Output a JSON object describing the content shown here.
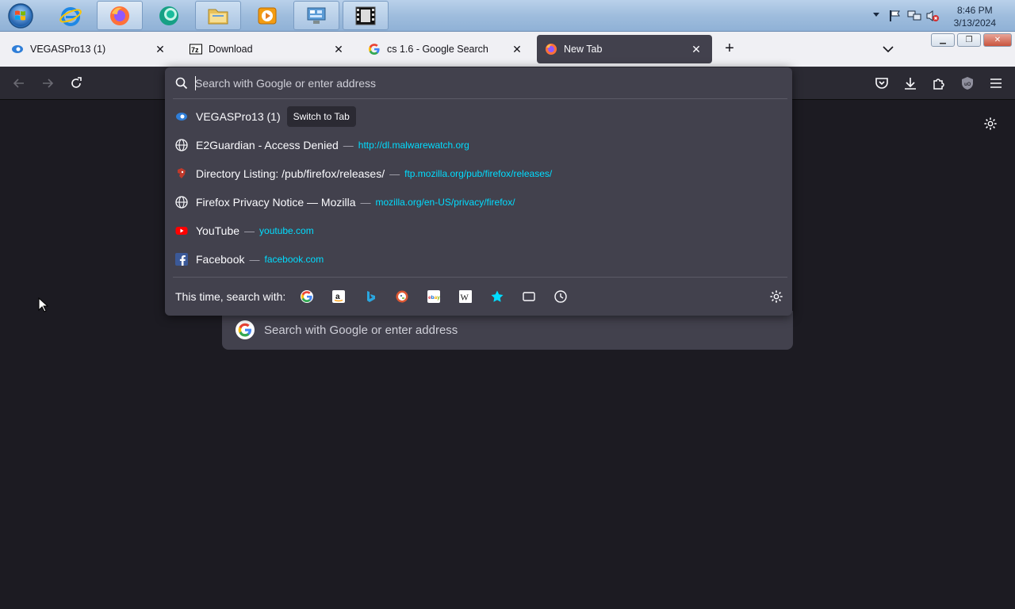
{
  "taskbar": {
    "apps": [
      {
        "name": "internet-explorer",
        "icon": "ie-icon"
      },
      {
        "name": "firefox",
        "icon": "firefox-icon"
      },
      {
        "name": "chat-app",
        "icon": "green-bubble-icon"
      },
      {
        "name": "file-explorer",
        "icon": "folder-icon"
      },
      {
        "name": "media-player",
        "icon": "media-player-icon"
      },
      {
        "name": "control-panel",
        "icon": "control-panel-icon"
      },
      {
        "name": "video-editor",
        "icon": "film-strip-icon"
      }
    ],
    "clock": {
      "time": "8:46 PM",
      "date": "3/13/2024"
    }
  },
  "tabs": [
    {
      "title": "VEGASPro13 (1)",
      "icon": "vegas-icon",
      "selected": false
    },
    {
      "title": "Download",
      "icon": "7zip-icon",
      "selected": false
    },
    {
      "title": "cs 1.6 - Google Search",
      "icon": "google-icon",
      "selected": false
    },
    {
      "title": "New Tab",
      "icon": "firefox-icon",
      "selected": true
    }
  ],
  "urlbar": {
    "placeholder": "Search with Google or enter address",
    "results": [
      {
        "title": "VEGASPro13 (1)",
        "action": "Switch to Tab",
        "url": "",
        "icon": "vegas-icon"
      },
      {
        "title": "E2Guardian - Access Denied",
        "url": "http://dl.malwarewatch.org",
        "icon": "globe-icon"
      },
      {
        "title": "Directory Listing: /pub/firefox/releases/",
        "url": "ftp.mozilla.org/pub/firefox/releases/",
        "icon": "mozilla-icon"
      },
      {
        "title": "Firefox Privacy Notice — Mozilla",
        "url": "mozilla.org/en-US/privacy/firefox/",
        "icon": "globe-icon"
      },
      {
        "title": "YouTube",
        "url": "youtube.com",
        "icon": "youtube-icon"
      },
      {
        "title": "Facebook",
        "url": "facebook.com",
        "icon": "facebook-icon"
      }
    ],
    "separator": "—",
    "oneoff_label": "This time, search with:",
    "engines": [
      "google",
      "amazon",
      "bing",
      "duckduckgo",
      "ebay",
      "wikipedia",
      "bookmarks",
      "tabs",
      "history"
    ]
  },
  "content": {
    "search_placeholder": "Search with Google or enter address"
  },
  "colors": {
    "accent_url": "#00ddff",
    "popup_bg": "#42414d",
    "page_bg": "#1c1b22",
    "toolbar_bg": "#2b2a33"
  }
}
